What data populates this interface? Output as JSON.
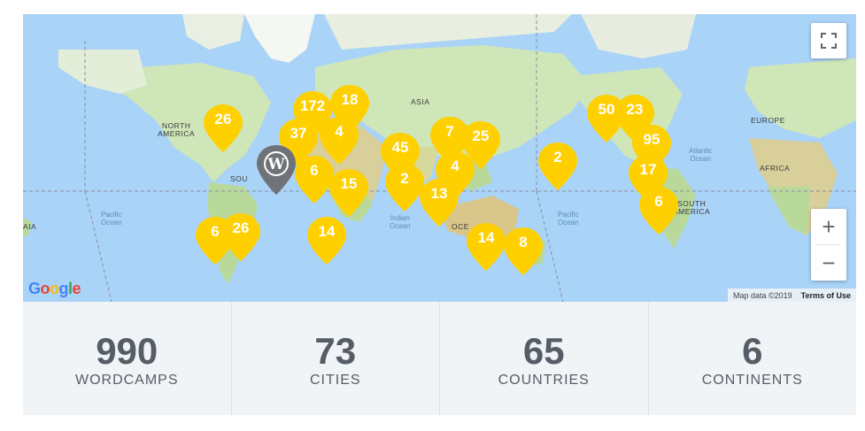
{
  "map": {
    "ocean_labels": [
      {
        "name": "pacific-ocean-label-west",
        "text": "Pacific\nOcean"
      },
      {
        "name": "indian-ocean-label",
        "text": "Indian\nOcean"
      },
      {
        "name": "pacific-ocean-label-east",
        "text": "Pacific\nOcean"
      },
      {
        "name": "atlantic-ocean-label",
        "text": "Atlantic\nOcean"
      }
    ],
    "land_labels": [
      {
        "name": "north-america-label",
        "text": "NORTH\nAMERICA"
      },
      {
        "name": "asia-label",
        "text": "ASIA"
      },
      {
        "name": "europe-label",
        "text": "EUROPE"
      },
      {
        "name": "africa-label",
        "text": "AFRICA"
      },
      {
        "name": "south-america-label",
        "text": "SOUTH\nAMERICA"
      },
      {
        "name": "south-america-partial-label",
        "text": "SOU"
      },
      {
        "name": "oceania-partial-label",
        "text": "OCE"
      },
      {
        "name": "asia-partial-label",
        "text": "AIA"
      }
    ],
    "markers": [
      {
        "count": "26"
      },
      {
        "count": "172"
      },
      {
        "count": "18"
      },
      {
        "count": "37"
      },
      {
        "count": "4"
      },
      {
        "count": "6"
      },
      {
        "count": "15"
      },
      {
        "count": "14"
      },
      {
        "count": "6"
      },
      {
        "count": "26"
      },
      {
        "count": "45"
      },
      {
        "count": "2"
      },
      {
        "count": "7"
      },
      {
        "count": "25"
      },
      {
        "count": "4"
      },
      {
        "count": "13"
      },
      {
        "count": "14"
      },
      {
        "count": "8"
      },
      {
        "count": "2"
      },
      {
        "count": "50"
      },
      {
        "count": "23"
      },
      {
        "count": "95"
      },
      {
        "count": "17"
      },
      {
        "count": "6"
      }
    ],
    "wordpress_marker": {
      "icon": "wordpress-logo-icon"
    },
    "controls": {
      "fullscreen_icon": "fullscreen-icon",
      "zoom_in": "+",
      "zoom_out": "−"
    },
    "google_logo": {
      "letters": [
        "G",
        "o",
        "o",
        "g",
        "l",
        "e"
      ],
      "colors": [
        "#4285F4",
        "#EA4335",
        "#FBBC05",
        "#4285F4",
        "#34A853",
        "#EA4335"
      ]
    },
    "attribution": {
      "map_data": "Map data ©2019",
      "terms": "Terms of Use"
    },
    "colors": {
      "marker": "#ffd000",
      "ocean": "#a9d3f7",
      "land": "#cfe6b8",
      "wp_marker": "#6f7378"
    }
  },
  "stats": [
    {
      "value": "990",
      "label": "WORDCAMPS"
    },
    {
      "value": "73",
      "label": "CITIES"
    },
    {
      "value": "65",
      "label": "COUNTRIES"
    },
    {
      "value": "6",
      "label": "CONTINENTS"
    }
  ]
}
